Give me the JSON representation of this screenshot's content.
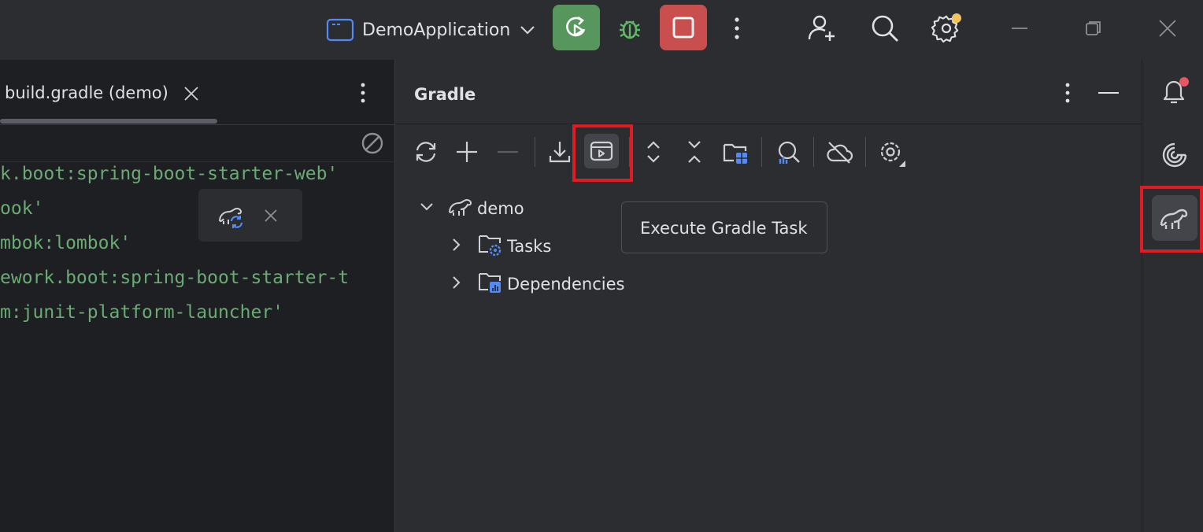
{
  "titlebar": {
    "run_config_name": "DemoApplication",
    "icons": [
      "window-icon",
      "chevron-down-icon",
      "rerun-icon",
      "debug-icon",
      "stop-icon",
      "more-vertical-icon",
      "add-user-icon",
      "search-icon",
      "settings-icon",
      "minimize-icon",
      "restore-icon",
      "close-icon"
    ],
    "run_color": "#57965c",
    "stop_color": "#c94f4f",
    "notification_dot_color": "#f2c55c"
  },
  "editor": {
    "tab_label": "build.gradle (demo)",
    "code_lines": [
      "k.boot:spring-boot-starter-web'",
      "ook'",
      "mbok:lombok'",
      "ework.boot:spring-boot-starter-t",
      "m:junit-platform-launcher'"
    ],
    "string_color": "#6aab73"
  },
  "gradle": {
    "title": "Gradle",
    "toolbar_icons": [
      "reload-icon",
      "add-icon",
      "remove-icon",
      "download-icon",
      "execute-task-icon",
      "expand-all-icon",
      "collapse-all-icon",
      "composite-build-icon",
      "analyze-dependencies-icon",
      "offline-mode-icon",
      "gradle-settings-icon"
    ],
    "tree": {
      "root": "demo",
      "children": [
        "Tasks",
        "Dependencies"
      ]
    },
    "tooltip": "Execute Gradle Task"
  },
  "right_strip": {
    "icons": [
      "notifications-icon",
      "ai-assistant-icon",
      "gradle-icon"
    ],
    "badge_color": "#e55765"
  },
  "highlight_color": "#e01b22"
}
